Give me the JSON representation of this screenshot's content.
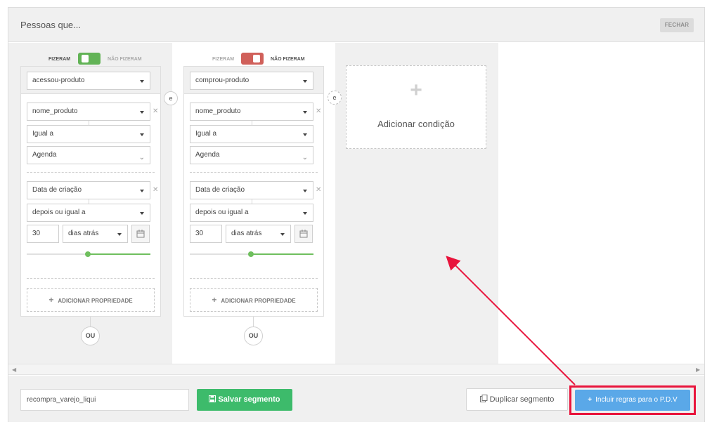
{
  "header": {
    "title": "Pessoas que...",
    "close_label": "FECHAR"
  },
  "toggle": {
    "did": "FIZERAM",
    "did_not": "NÃO FIZERAM"
  },
  "conditions": [
    {
      "state": "did",
      "event": "acessou-produto",
      "properties": [
        {
          "field": "nome_produto",
          "operator": "Igual a",
          "value": "Agenda"
        },
        {
          "field": "Data de criação",
          "operator": "depois ou igual a",
          "number": "30",
          "unit": "dias atrás"
        }
      ],
      "add_property_label": "ADICIONAR PROPRIEDADE",
      "or_label": "OU"
    },
    {
      "state": "did_not",
      "event": "comprou-produto",
      "properties": [
        {
          "field": "nome_produto",
          "operator": "Igual a",
          "value": "Agenda"
        },
        {
          "field": "Data de criação",
          "operator": "depois ou igual a",
          "number": "30",
          "unit": "dias atrás"
        }
      ],
      "add_property_label": "ADICIONAR PROPRIEDADE",
      "or_label": "OU"
    }
  ],
  "and_label": "e",
  "add_condition_label": "Adicionar condição",
  "footer": {
    "segment_name": "recompra_varejo_liqui",
    "save_label": "Salvar segmento",
    "duplicate_label": "Duplicar segmento",
    "pdv_label": "Incluir regras para o P.D.V"
  },
  "colors": {
    "save": "#3dbb6b",
    "pdv": "#5aa8e8",
    "highlight": "#e8143c",
    "toggle_on": "#62b356",
    "toggle_off": "#d0605a"
  }
}
